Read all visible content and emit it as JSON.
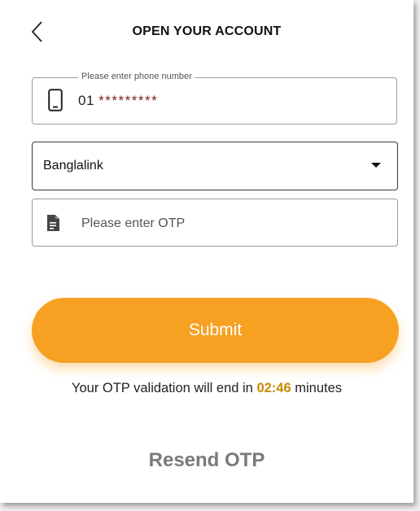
{
  "header": {
    "title": "OPEN YOUR ACCOUNT",
    "back_icon": "chevron-left-icon"
  },
  "phone": {
    "label": "Please enter phone number",
    "prefix": "01",
    "masked": "*********",
    "icon": "smartphone-icon"
  },
  "operator": {
    "selected": "Banglalink",
    "icon": "dropdown-caret-icon"
  },
  "otp": {
    "placeholder": "Please enter OTP",
    "icon": "document-icon"
  },
  "submit": {
    "label": "Submit",
    "color": "#f7a123"
  },
  "timer": {
    "prefix": "Your OTP validation will end in",
    "time": "02:46",
    "suffix": "minutes",
    "time_color": "#c68a00"
  },
  "resend": {
    "label": "Resend OTP"
  }
}
